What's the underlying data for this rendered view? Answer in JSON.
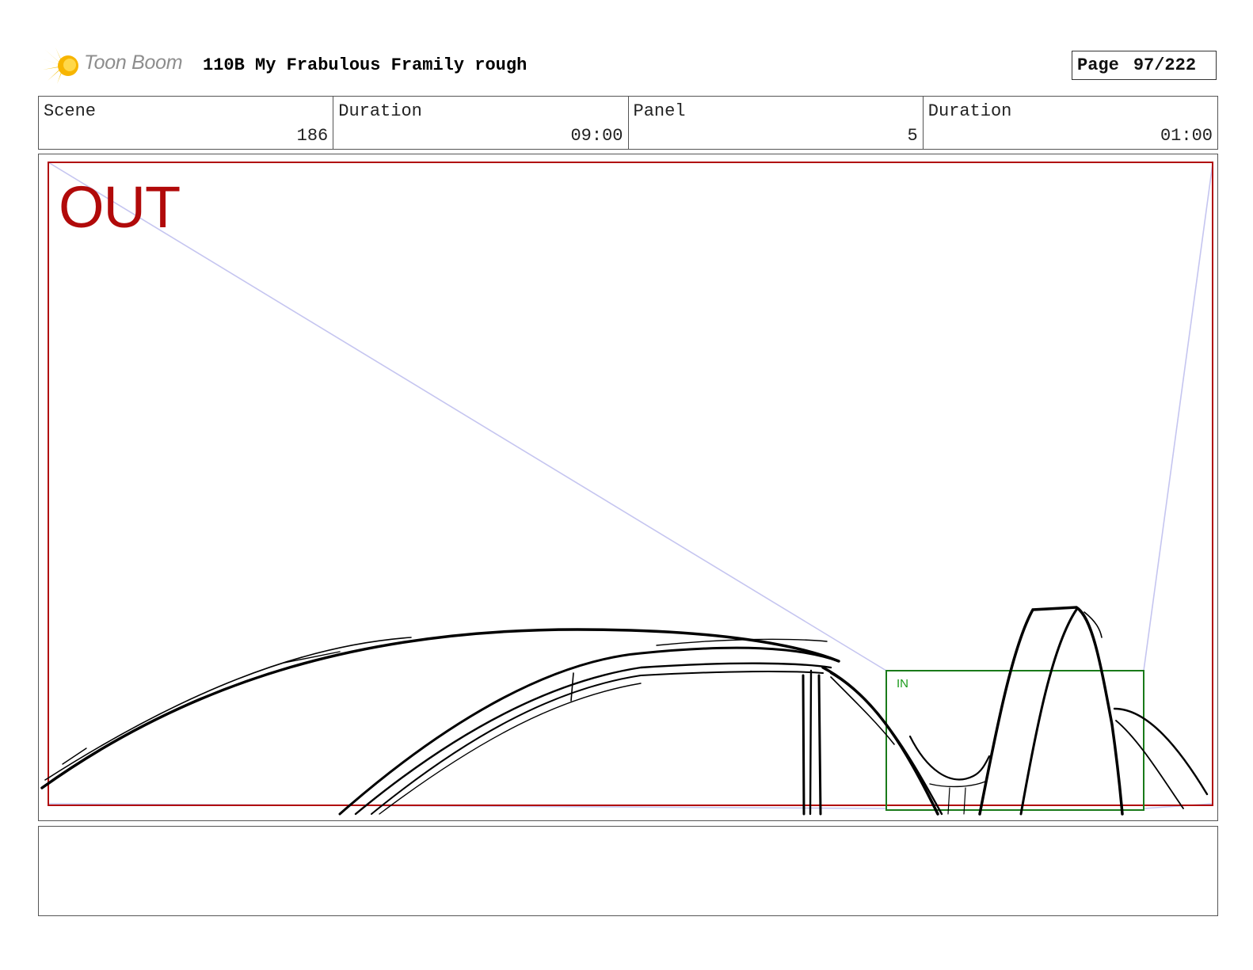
{
  "header": {
    "logo_text": "Toon Boom",
    "title": "110B My Frabulous Framily rough",
    "page_label": "Page",
    "page_number": "97/222"
  },
  "info": {
    "scene_label": "Scene",
    "scene_value": "186",
    "scene_duration_label": "Duration",
    "scene_duration_value": "09:00",
    "panel_label": "Panel",
    "panel_value": "5",
    "panel_duration_label": "Duration",
    "panel_duration_value": "01:00"
  },
  "panel": {
    "out_label": "OUT",
    "in_label": "IN"
  },
  "colors": {
    "out_frame": "#b10a0a",
    "in_frame": "#1a7a1a",
    "camera_lines": "#c5c5f0",
    "sketch": "#000000",
    "logo_burst": "#f5c518"
  },
  "notes": {}
}
